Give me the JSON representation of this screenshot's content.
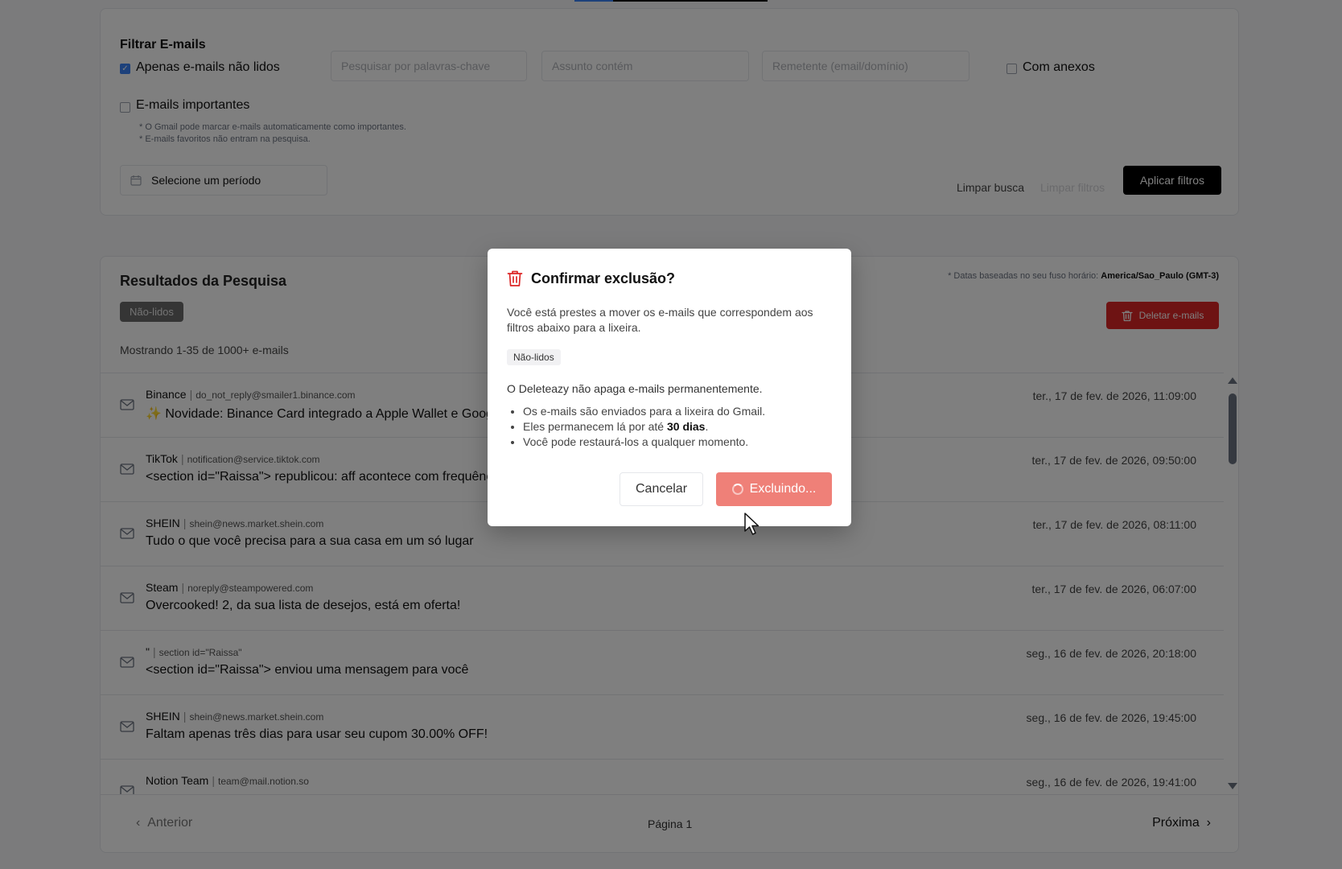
{
  "filters": {
    "title": "Filtrar E-mails",
    "unread_only": {
      "label": "Apenas e-mails não lidos",
      "checked": true
    },
    "keywords": {
      "placeholder": "Pesquisar por palavras-chave",
      "value": ""
    },
    "subject": {
      "placeholder": "Assunto contém",
      "value": ""
    },
    "sender": {
      "placeholder": "Remetente (email/domínio)",
      "value": ""
    },
    "attachments": {
      "label": "Com anexos",
      "checked": false
    },
    "important": {
      "label": "E-mails importantes",
      "checked": false
    },
    "notes": [
      "* O Gmail pode marcar e-mails automaticamente como importantes.",
      "* E-mails favoritos não entram na pesquisa."
    ],
    "period_label": "Selecione um período",
    "clear_search": "Limpar busca",
    "clear_filters": "Limpar filtros",
    "apply": "Aplicar filtros"
  },
  "results": {
    "title": "Resultados da Pesquisa",
    "timezone_prefix": "* Datas baseadas no seu fuso horário:",
    "timezone": "America/Sao_Paulo (GMT-3)",
    "active_chip": "Não-lidos",
    "delete_label": "Deletar e-mails",
    "count_text": "Mostrando 1-35 de 1000+ e-mails",
    "emails": [
      {
        "sender": "Binance",
        "address": "do_not_reply@smailer1.binance.com",
        "subject": "✨ Novidade: Binance Card integrado a Apple Wallet e Google Pay",
        "date": "ter., 17 de fev. de 2026, 11:09:00"
      },
      {
        "sender": "TikTok",
        "address": "notification@service.tiktok.com",
        "subject": "<section id=\"Raissa\"> republicou: aff acontece com frequência",
        "date": "ter., 17 de fev. de 2026, 09:50:00"
      },
      {
        "sender": "SHEIN",
        "address": "shein@news.market.shein.com",
        "subject": "Tudo o que você precisa para a sua casa em um só lugar",
        "date": "ter., 17 de fev. de 2026, 08:11:00"
      },
      {
        "sender": "Steam",
        "address": "noreply@steampowered.com",
        "subject": "Overcooked! 2, da sua lista de desejos, está em oferta!",
        "date": "ter., 17 de fev. de 2026, 06:07:00"
      },
      {
        "sender": "\"",
        "address": "section id=\"Raissa\"",
        "subject": "<section id=\"Raissa\"> enviou uma mensagem para você",
        "date": "seg., 16 de fev. de 2026, 20:18:00"
      },
      {
        "sender": "SHEIN",
        "address": "shein@news.market.shein.com",
        "subject": "Faltam apenas três dias para usar seu cupom 30.00% OFF!",
        "date": "seg., 16 de fev. de 2026, 19:45:00"
      },
      {
        "sender": "Notion Team",
        "address": "team@mail.notion.so",
        "subject": "",
        "date": "seg., 16 de fev. de 2026, 19:41:00"
      }
    ],
    "pagination": {
      "prev": "Anterior",
      "page": "Página 1",
      "next": "Próxima"
    }
  },
  "modal": {
    "title": "Confirmar exclusão?",
    "description": "Você está prestes a mover os e-mails que correspondem aos filtros abaixo para a lixeira.",
    "chip": "Não-lidos",
    "info": "O Deleteazy não apaga e-mails permanentemente.",
    "bullets": {
      "one": "Os e-mails são enviados para a lixeira do Gmail.",
      "two_prefix": "Eles permanecem lá por até",
      "two_bold": "30 dias",
      "two_suffix": ".",
      "three": "Você pode restaurá-los a qualquer momento."
    },
    "cancel": "Cancelar",
    "confirm_loading": "Excluindo..."
  },
  "colors": {
    "accent": "#3b82f6",
    "danger": "#dc2626",
    "danger_loading": "#ef8078",
    "primary": "#000000"
  }
}
